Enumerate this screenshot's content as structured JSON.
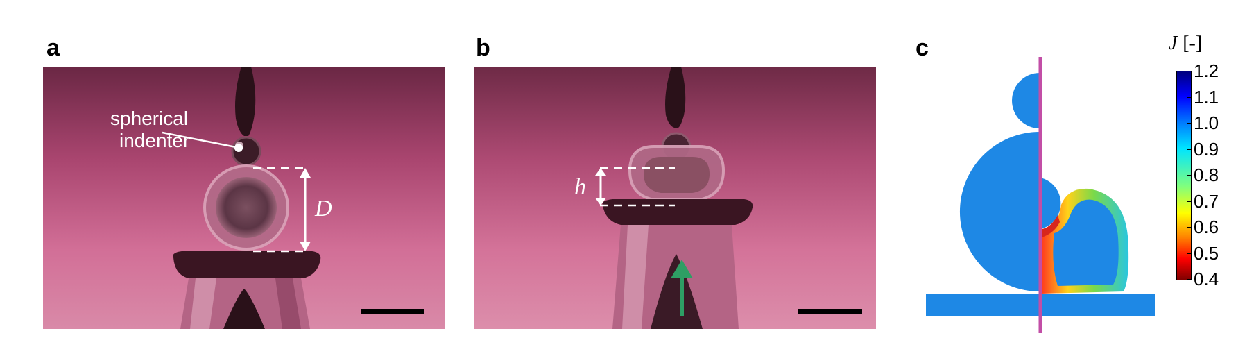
{
  "panels": {
    "a": {
      "letter": "a",
      "indenter_label_line1": "spherical",
      "indenter_label_line2": "indenter",
      "dimension_label": "D"
    },
    "b": {
      "letter": "b",
      "dimension_label": "h"
    },
    "c": {
      "letter": "c"
    }
  },
  "colorbar": {
    "title_symbol": "J",
    "title_unit": "[-]",
    "ticks": [
      "1.2",
      "1.1",
      "1.0",
      "0.9",
      "0.8",
      "0.7",
      "0.6",
      "0.5",
      "0.4"
    ],
    "range": [
      0.4,
      1.2
    ],
    "colormap": "jet"
  },
  "colors": {
    "background_top": "#6e2a45",
    "background_bottom": "#d98aa8",
    "divider_line": "#c24ea6",
    "fluid_blue": "#1e88e5",
    "arrow_green": "#2e9e64",
    "dashed_lines": "#ffffff",
    "scale_bar": "#000000"
  }
}
